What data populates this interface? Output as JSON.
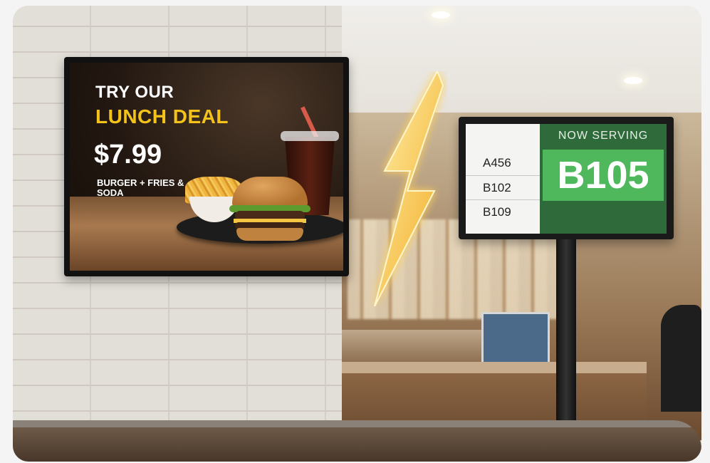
{
  "menu_sign": {
    "line1": "TRY OUR",
    "line2": "LUNCH DEAL",
    "price": "$7.99",
    "description": "BURGER + FRIES & SODA",
    "accent_color": "#f3c21b"
  },
  "now_serving_sign": {
    "header": "NOW SERVING",
    "current": "B105",
    "queue": [
      "A456",
      "B102",
      "B109"
    ],
    "panel_color": "#2f6b3a",
    "highlight_color": "#4fb85c"
  },
  "icons": [
    "lightning-bolt-icon"
  ]
}
